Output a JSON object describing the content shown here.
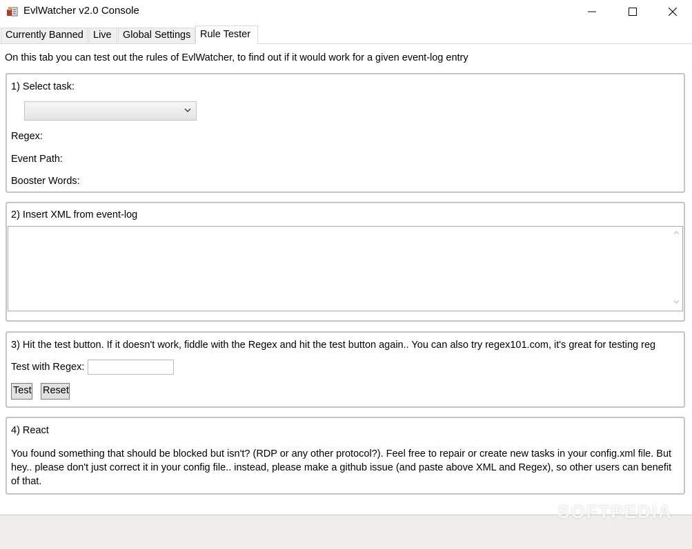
{
  "window": {
    "title": "EvlWatcher v2.0 Console"
  },
  "tabs": [
    {
      "label": "Currently Banned"
    },
    {
      "label": "Live"
    },
    {
      "label": "Global Settings"
    },
    {
      "label": "Rule Tester"
    }
  ],
  "active_tab": "Rule Tester",
  "intro": "On this tab you can test out the rules of EvlWatcher, to find out if it would work for a given event-log entry",
  "section1": {
    "header": "1) Select task:",
    "task_value": "",
    "regex_label": "Regex:",
    "event_path_label": "Event Path:",
    "booster_words_label": "Booster Words:"
  },
  "section2": {
    "header": "2) Insert XML from event-log",
    "xml_value": ""
  },
  "section3": {
    "header": "3) Hit the test button. If it doesn't work, fiddle with the Regex and hit the test button again.. You can also try regex101.com, it's great for testing reg",
    "test_with_regex_label": "Test with Regex:",
    "regex_input_value": "",
    "test_button": "Test",
    "reset_button": "Reset"
  },
  "section4": {
    "header": "4) React",
    "body": "You found something that should be blocked but isn't? (RDP or any other protocol?). Feel free to repair or create new tasks in your config.xml file. But hey.. please don't just correct it in your config file.. instead, please make a github issue (and paste above XML and Regex), so other users can benefit of that."
  },
  "watermark": "SOFTPEDIA"
}
